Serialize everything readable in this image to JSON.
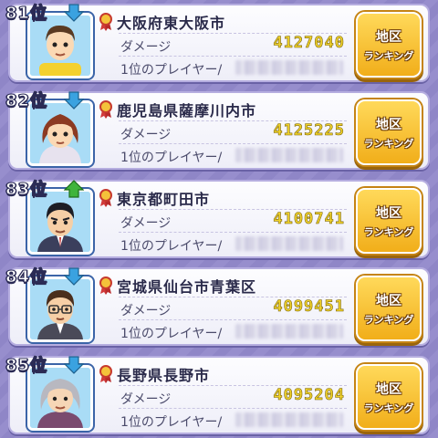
{
  "colors": {
    "damage_value": "#f0d22a",
    "button": "#f6b824",
    "rank_up": "#3fb43c",
    "rank_down": "#3aa2e0",
    "background": "#8f86c7"
  },
  "labels": {
    "rank_suffix": "位",
    "damage": "ダメージ",
    "top_player": "1位のプレイヤー/",
    "button_line1": "地区",
    "button_line2": "ランキング"
  },
  "entries": [
    {
      "rank": "81",
      "trend": "down",
      "trend_icon": "arrow-down-icon",
      "region": "大阪府東大阪市",
      "damage": "4127040",
      "avatar": "boy-character"
    },
    {
      "rank": "82",
      "trend": "down",
      "trend_icon": "arrow-down-icon",
      "region": "鹿児島県薩摩川内市",
      "damage": "4125225",
      "avatar": "girl-character"
    },
    {
      "rank": "83",
      "trend": "up",
      "trend_icon": "arrow-up-icon",
      "region": "東京都町田市",
      "damage": "4100741",
      "avatar": "suit-man-character"
    },
    {
      "rank": "84",
      "trend": "down",
      "trend_icon": "arrow-down-icon",
      "region": "宮城県仙台市青葉区",
      "damage": "4099451",
      "avatar": "glasses-man-character"
    },
    {
      "rank": "85",
      "trend": "down",
      "trend_icon": "arrow-down-icon",
      "region": "長野県長野市",
      "damage": "4095204",
      "avatar": "grandma-character"
    }
  ]
}
